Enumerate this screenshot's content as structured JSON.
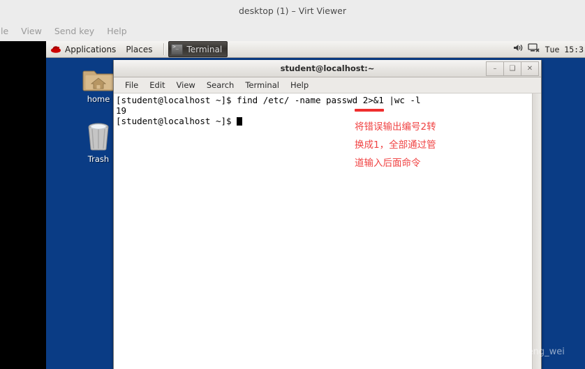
{
  "viewer": {
    "title": "desktop (1) – Virt Viewer",
    "menu": [
      "le",
      "View",
      "Send key",
      "Help"
    ]
  },
  "gnome_panel": {
    "redhat_icon": "redhat-shadowman-icon",
    "applications_label": "Applications",
    "places_label": "Places",
    "task": {
      "icon": "terminal-icon",
      "label": "Terminal"
    },
    "tray": {
      "volume_icon": "volume-speaker-icon",
      "network_icon": "network-disconnected-icon",
      "clock": "Tue 15:3"
    }
  },
  "desktop": {
    "icons": [
      {
        "name": "home-folder-icon",
        "label": "home"
      },
      {
        "name": "trash-icon",
        "label": "Trash"
      }
    ]
  },
  "terminal": {
    "title": "student@localhost:~",
    "window_buttons": [
      {
        "name": "minimize-button",
        "glyph": "–"
      },
      {
        "name": "maximize-button",
        "glyph": "❑"
      },
      {
        "name": "close-button",
        "glyph": "✕"
      }
    ],
    "menu": [
      "File",
      "Edit",
      "View",
      "Search",
      "Terminal",
      "Help"
    ],
    "lines": [
      "[student@localhost ~]$ find /etc/ -name passwd 2>&1 |wc -l",
      "19",
      "[student@localhost ~]$ "
    ],
    "prompt": "[student@localhost ~]$ ",
    "command": "find /etc/ -name passwd 2>&1 |wc -l",
    "output": "19"
  },
  "annotations": {
    "underline_target": "2>&1",
    "note_lines": [
      "将错误输出编号2转",
      "换成1，全部通过管",
      "道输入后面命令"
    ],
    "color": "#f04343"
  },
  "watermark": {
    "text": "https://blog.csdn.net/shang_feng_wei"
  },
  "colors": {
    "desktop_blue": "#0a3c85",
    "panel_grey": "#ececec",
    "terminal_bg": "#ffffff",
    "annotation_red": "#f04343"
  }
}
